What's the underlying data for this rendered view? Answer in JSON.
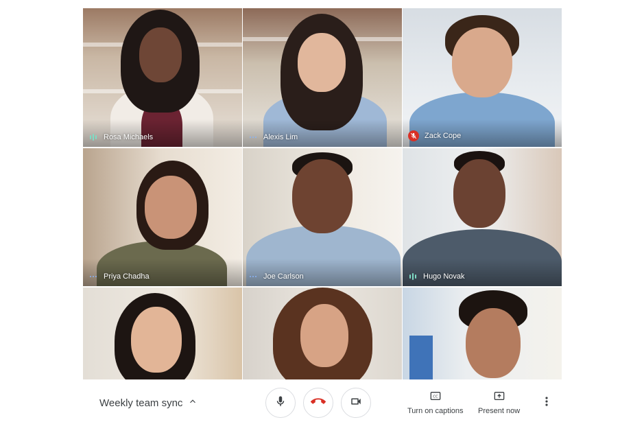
{
  "meeting": {
    "title": "Weekly team sync",
    "title_expand_icon": "chevron-up-icon"
  },
  "participants": [
    {
      "name": "Rosa Michaels",
      "status": "speaking",
      "status_icon": "audio-level-icon",
      "status_color": "#7fdcc5"
    },
    {
      "name": "Alexis Lim",
      "status": "idle",
      "status_icon": "audio-idle-icon",
      "status_color": "#8ab4f8"
    },
    {
      "name": "Zack Cope",
      "status": "muted",
      "status_icon": "mic-off-icon",
      "status_color": "#d93025"
    },
    {
      "name": "Priya Chadha",
      "status": "idle",
      "status_icon": "audio-idle-icon",
      "status_color": "#8ab4f8"
    },
    {
      "name": "Joe Carlson",
      "status": "idle",
      "status_icon": "audio-idle-icon",
      "status_color": "#8ab4f8"
    },
    {
      "name": "Hugo Novak",
      "status": "speaking",
      "status_icon": "audio-level-icon",
      "status_color": "#7fdcc5"
    },
    {
      "name": "",
      "status": "",
      "status_icon": "",
      "status_color": ""
    },
    {
      "name": "",
      "status": "",
      "status_icon": "",
      "status_color": ""
    },
    {
      "name": "",
      "status": "",
      "status_icon": "",
      "status_color": ""
    }
  ],
  "controls": {
    "mic_icon": "mic-icon",
    "hangup_icon": "hang-up-icon",
    "hangup_color": "#d93025",
    "camera_icon": "video-camera-icon",
    "captions_icon": "closed-captions-icon",
    "captions_label": "Turn on captions",
    "present_icon": "present-screen-icon",
    "present_label": "Present now",
    "more_icon": "more-vertical-icon"
  }
}
